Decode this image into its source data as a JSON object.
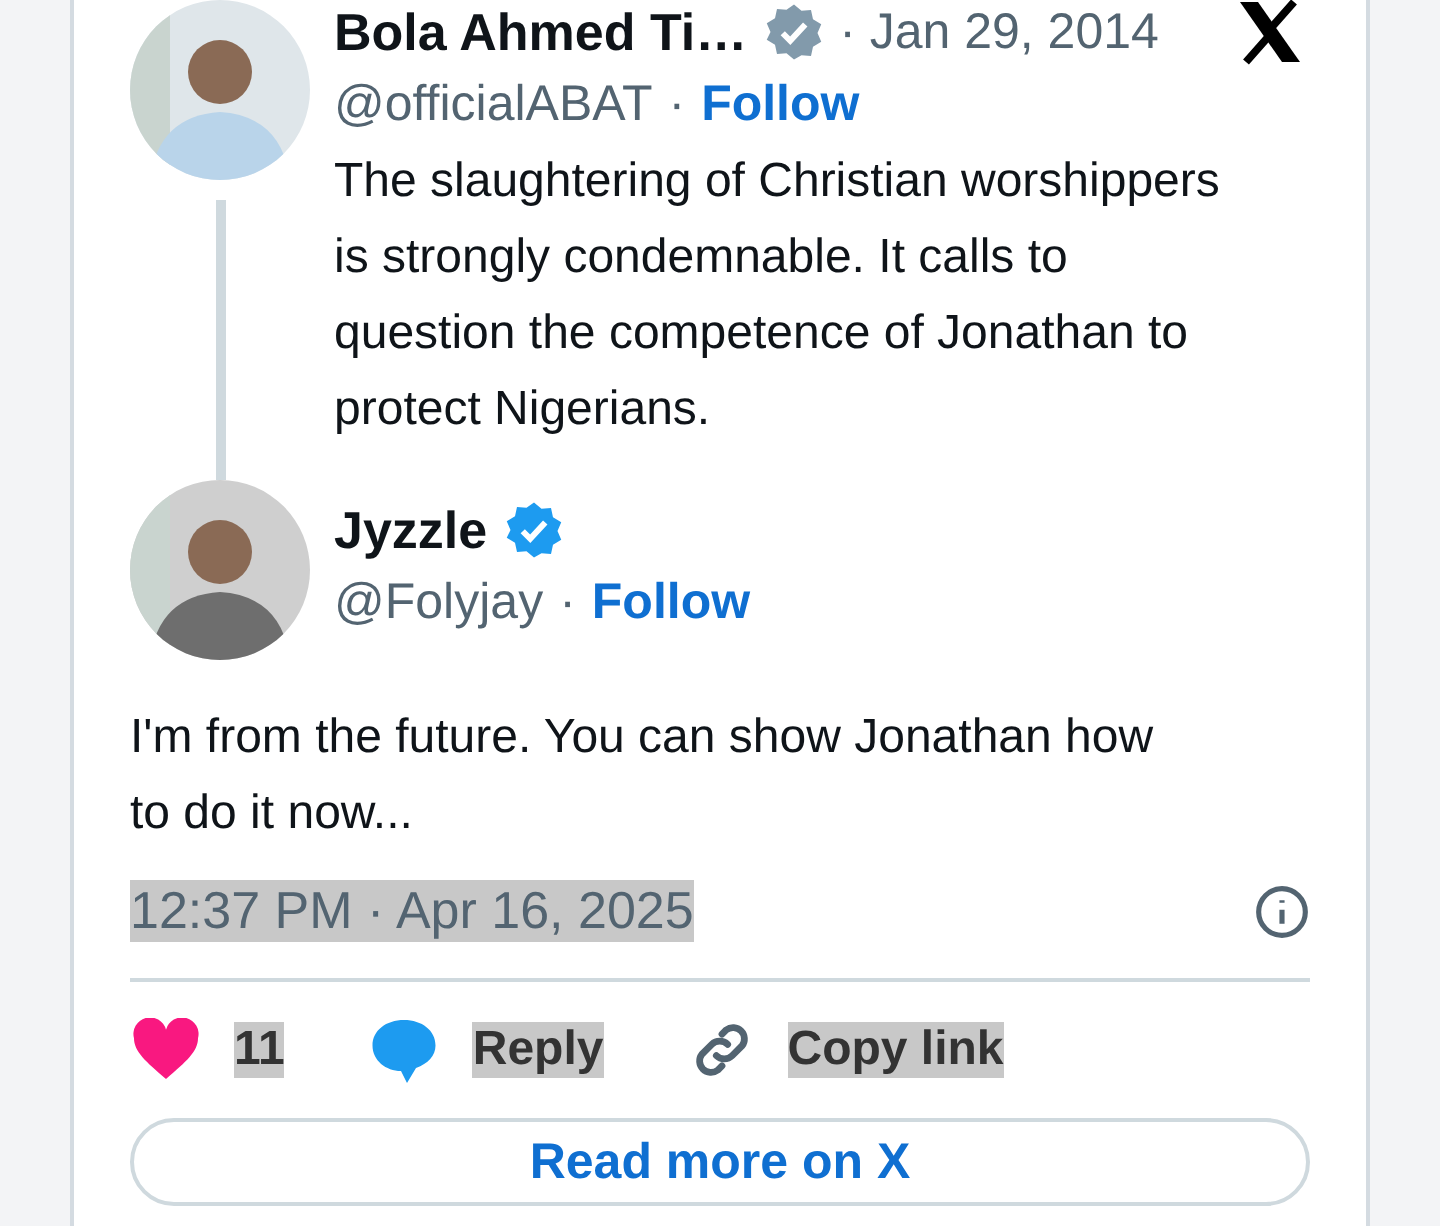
{
  "quoted_tweet": {
    "author_name": "Bola Ahmed Ti…",
    "verified": true,
    "date": "· Jan 29, 2014",
    "handle": "@officialABAT",
    "separator": "·",
    "follow": "Follow",
    "text": "The slaughtering of Christian worshippers  is strongly condemnable. It calls to question the competence of Jonathan to protect Nigerians."
  },
  "tweet": {
    "author_name": "Jyzzle",
    "verified": true,
    "handle": "@Folyjay",
    "separator": "·",
    "follow": "Follow",
    "text": "I'm from the future. You can show Jonathan how to do it now...",
    "timestamp": {
      "text": "12:37 PM · Apr 16, 2025",
      "highlighted": true
    }
  },
  "actions": [
    {
      "kind": "like",
      "label": "11",
      "highlighted": true
    },
    {
      "kind": "reply",
      "label": "Reply",
      "highlighted": true
    },
    {
      "kind": "copy",
      "label": "Copy link",
      "highlighted": true
    }
  ],
  "read_more": "Read more on X"
}
